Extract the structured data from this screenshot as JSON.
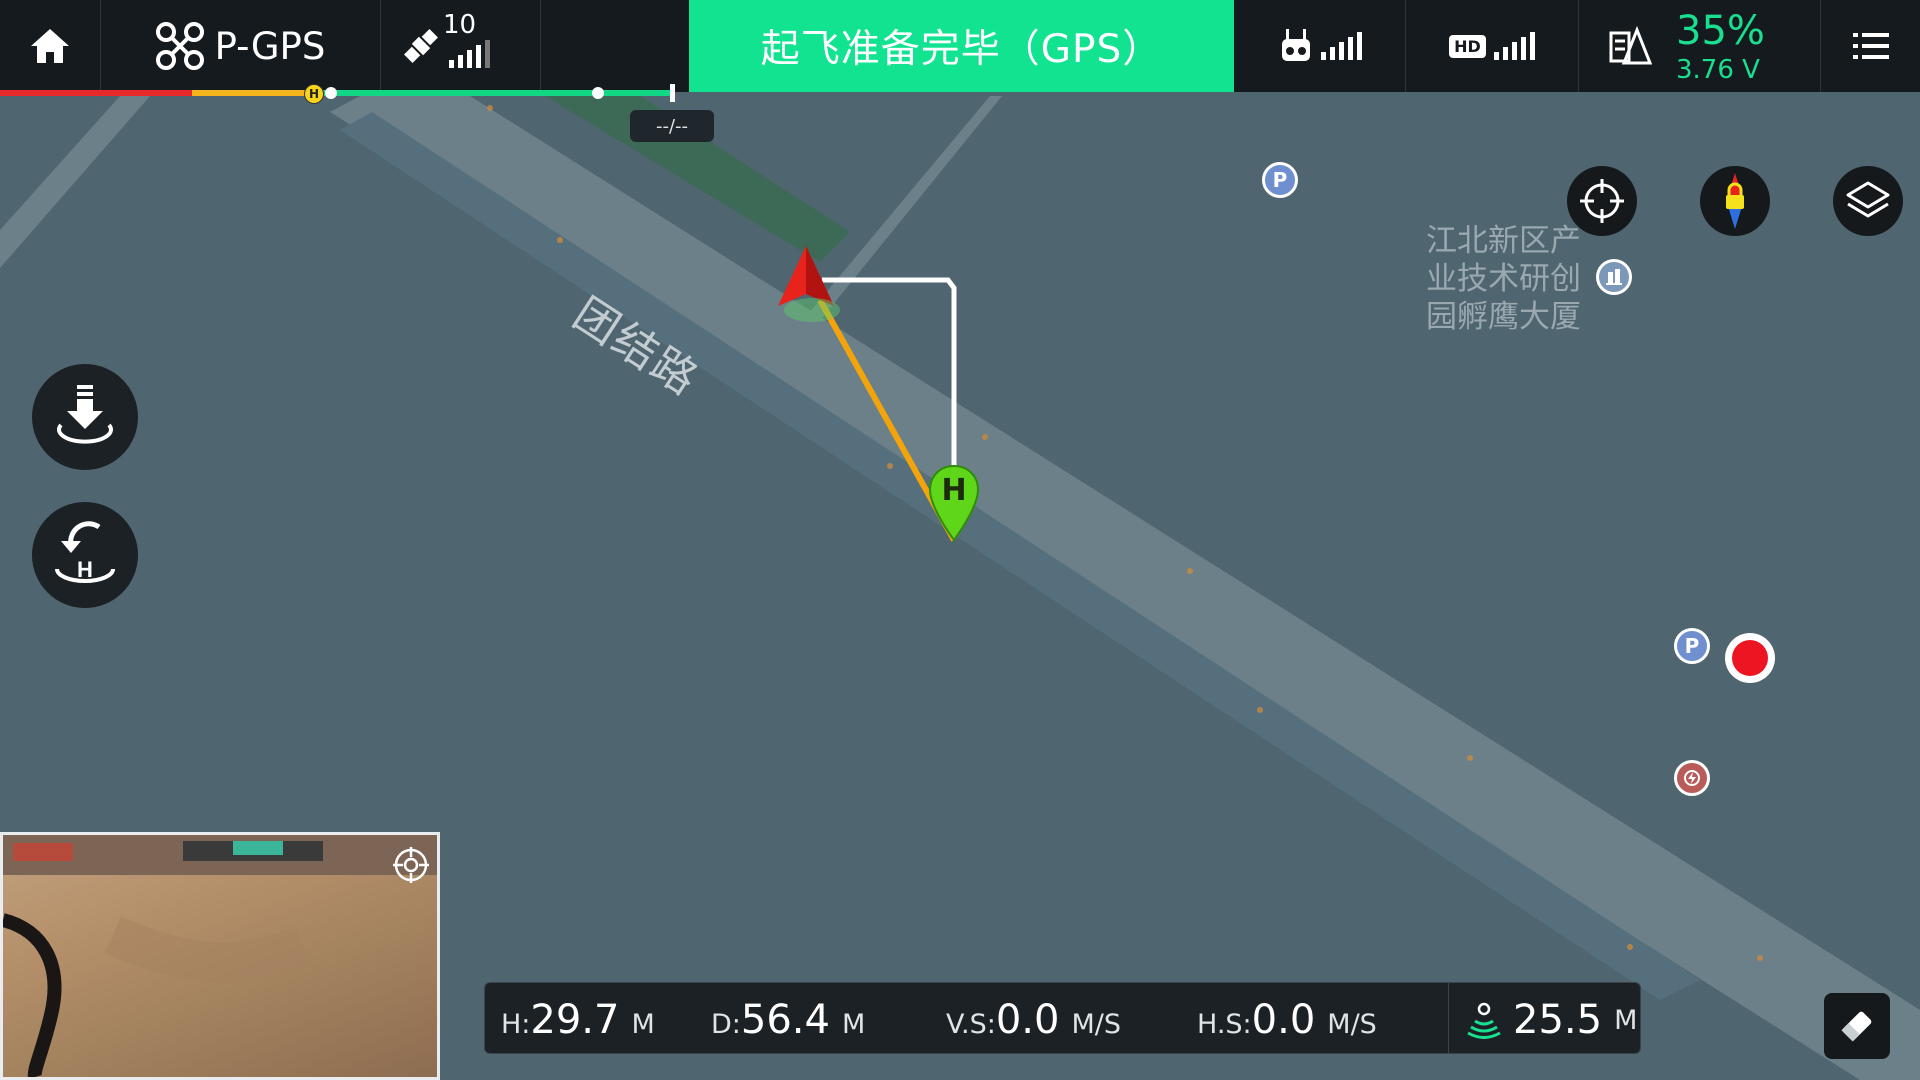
{
  "topbar": {
    "flight_mode": "P-GPS",
    "satellite_count": "10",
    "status_text": "起飞准备完毕（GPS）",
    "battery_percent": "35%",
    "battery_voltage": "3.76 V",
    "hd_label": "HD"
  },
  "timeline": {
    "home_marker": "H",
    "time_label": "--/--"
  },
  "map": {
    "road_name": "团结路",
    "poi_label": [
      "江北新区产",
      "业技术研创",
      "园孵鹰大厦"
    ],
    "home_pin": "H",
    "parking_marker": "P"
  },
  "telemetry": {
    "height_key": "H:",
    "height_value": "29.7",
    "height_unit": "M",
    "distance_key": "D:",
    "distance_value": "56.4",
    "distance_unit": "M",
    "vs_key": "V.S:",
    "vs_value": "0.0",
    "vs_unit": "M/S",
    "hs_key": "H.S:",
    "hs_value": "0.0",
    "hs_unit": "M/S",
    "vps_value": "25.5",
    "vps_unit": "M"
  },
  "colors": {
    "status_green": "#11e391",
    "battery_green": "#18e08f",
    "map_bg": "#4f6570",
    "road": "#6c8089",
    "flight_path": "#f2a40a",
    "aircraft_red": "#e8231c"
  },
  "icons": [
    "home-icon",
    "drone-icon",
    "satellite-icon",
    "signal-bars-icon",
    "remote-controller-icon",
    "hd-video-icon",
    "battery-icon",
    "menu-icon",
    "locate-icon",
    "compass-icon",
    "layers-icon",
    "takeoff-icon",
    "return-home-icon",
    "record-icon",
    "parking-icon",
    "building-icon",
    "charging-icon",
    "crosshair-icon",
    "vps-icon",
    "eraser-icon"
  ]
}
